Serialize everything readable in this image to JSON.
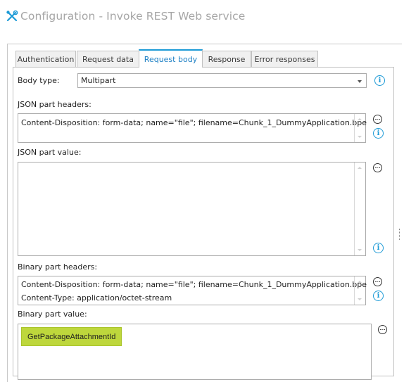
{
  "window": {
    "title": "Configuration - Invoke REST Web service",
    "icon": "tools-icon"
  },
  "tabs": [
    {
      "label": "Authentication",
      "active": false
    },
    {
      "label": "Request data",
      "active": false
    },
    {
      "label": "Request body",
      "active": true
    },
    {
      "label": "Response",
      "active": false
    },
    {
      "label": "Error responses",
      "active": false
    }
  ],
  "body_type": {
    "label": "Body type:",
    "value": "Multipart"
  },
  "json_part_headers": {
    "label": "JSON part headers:",
    "lines": [
      "Content-Disposition: form-data; name=\"file\"; filename=Chunk_1_DummyApplication.bpe"
    ]
  },
  "json_part_value": {
    "label": "JSON part value:",
    "value": ""
  },
  "binary_part_headers": {
    "label": "Binary part headers:",
    "lines": [
      "Content-Disposition: form-data; name=\"file\"; filename=Chunk_1_DummyApplication.bpe",
      "Content-Type: application/octet-stream"
    ]
  },
  "binary_part_value": {
    "label": "Binary part value:",
    "token": "GetPackageAttachmentId",
    "token_color": "#bed73c"
  },
  "colors": {
    "accent": "#1c9ad6",
    "title": "#a6a6a6"
  }
}
